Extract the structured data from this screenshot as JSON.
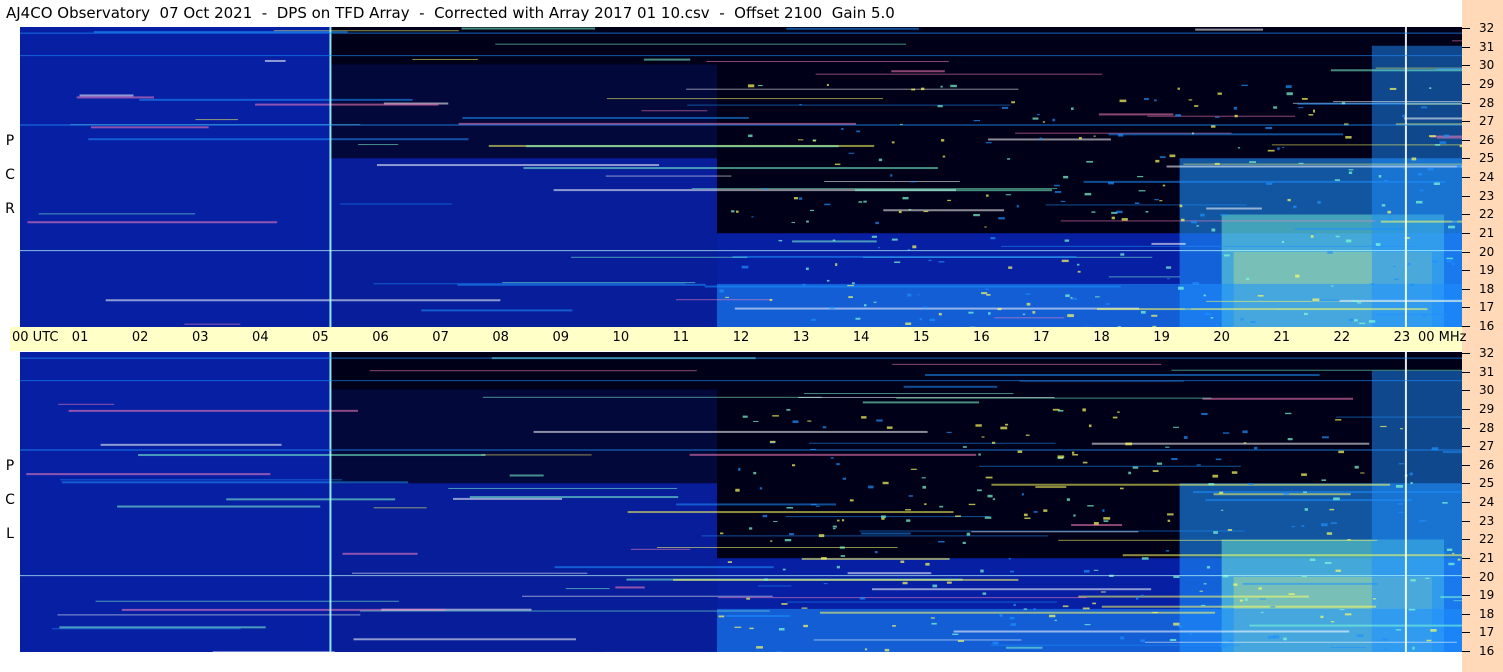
{
  "title": "AJ4CO Observatory  07 Oct 2021  -  DPS on TFD Array  -  Corrected with Array 2017 01 10.csv  -  Offset 2100  Gain 5.0",
  "panels": [
    {
      "id": "rcp",
      "letters": [
        "P",
        "C",
        "R"
      ]
    },
    {
      "id": "lcp",
      "letters": [
        "P",
        "C",
        "L"
      ]
    }
  ],
  "chart_data": {
    "type": "heatmap",
    "title": "AJ4CO Observatory  07 Oct 2021  -  DPS on TFD Array  -  Corrected with Array 2017 01 10.csv  -  Offset 2100  Gain 5.0",
    "xlabel": "UTC",
    "ylabel": "MHz",
    "x_ticks": [
      "00",
      "01",
      "02",
      "03",
      "04",
      "05",
      "06",
      "07",
      "08",
      "09",
      "10",
      "11",
      "12",
      "13",
      "14",
      "15",
      "16",
      "17",
      "18",
      "19",
      "20",
      "21",
      "22",
      "23",
      "00"
    ],
    "x_range": [
      0,
      24
    ],
    "y_ticks": [
      32,
      31,
      30,
      29,
      28,
      27,
      26,
      25,
      24,
      23,
      22,
      21,
      20,
      19,
      18,
      17,
      16
    ],
    "y_range": [
      16,
      32
    ],
    "series": [
      {
        "name": "RCP",
        "labels": [
          "P",
          "C",
          "R"
        ]
      },
      {
        "name": "LCP",
        "labels": [
          "P",
          "C",
          "L"
        ]
      }
    ],
    "colors": {
      "background_dark": "#000018",
      "low": "#0a2ad0",
      "mid": "#1e90ff",
      "high": "#7fffd4",
      "peak": "#ffff60"
    }
  }
}
